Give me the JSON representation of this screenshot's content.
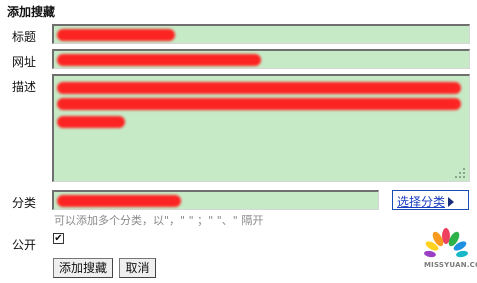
{
  "form": {
    "title": "添加搜藏",
    "title_label": "标题",
    "url_label": "网址",
    "desc_label": "描述",
    "category_label": "分类",
    "public_label": "公开",
    "category_hint": "可以添加多个分类，以\"，\" \" ；\" \"、\" 隔开",
    "choose_category_link": "选择分类",
    "public_checked": true,
    "public_check_glyph": "✔",
    "submit_button": "添加搜藏",
    "cancel_button": "取消"
  },
  "watermark": {
    "text": "MISSYUAN.COM"
  },
  "colors": {
    "field_bg": "#c6e9c6",
    "redaction": "#ff1a1a",
    "link": "#1a3fc0"
  },
  "icons": [
    "checkbox-check-icon",
    "triangle-right-icon",
    "resize-grip-icon",
    "peacock-logo-icon"
  ]
}
